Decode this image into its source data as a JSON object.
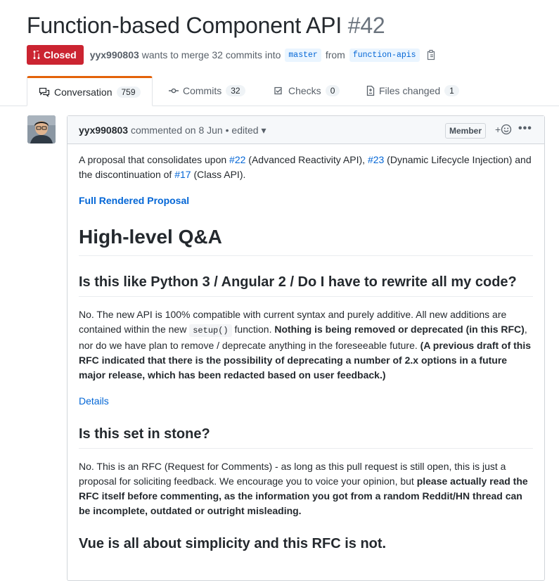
{
  "pr": {
    "title": "Function-based Component API",
    "number": "#42",
    "state": "Closed",
    "author": "yyx990803",
    "merge_text": "wants to merge 32 commits into",
    "base_branch": "master",
    "from_text": "from",
    "head_branch": "function-apis"
  },
  "tabs": [
    {
      "label": "Conversation",
      "count": "759"
    },
    {
      "label": "Commits",
      "count": "32"
    },
    {
      "label": "Checks",
      "count": "0"
    },
    {
      "label": "Files changed",
      "count": "1"
    }
  ],
  "comment": {
    "author": "yyx990803",
    "action": "commented on 8 Jun",
    "edited": "edited",
    "role": "Member",
    "more": "•••",
    "intro": {
      "t1": "A proposal that consolidates upon ",
      "l1": "#22",
      "t2": " (Advanced Reactivity API), ",
      "l2": "#23",
      "t3": " (Dynamic Lifecycle Injection) and the discontinuation of ",
      "l3": "#17",
      "t4": " (Class API)."
    },
    "rendered_link": "Full Rendered Proposal",
    "h_qa": "High-level Q&A",
    "q1": "Is this like Python 3 / Angular 2 / Do I have to rewrite all my code?",
    "a1": {
      "t1": "No. The new API is 100% compatible with current syntax and purely additive. All new additions are contained within the new ",
      "code": "setup()",
      "t2": " function. ",
      "b1": "Nothing is being removed or deprecated (in this RFC)",
      "t3": ", nor do we have plan to remove / deprecate anything in the foreseeable future. ",
      "b2": "(A previous draft of this RFC indicated that there is the possibility of deprecating a number of 2.x options in a future major release, which has been redacted based on user feedback.)"
    },
    "details_link": "Details",
    "q2": "Is this set in stone?",
    "a2": {
      "t1": "No. This is an RFC (Request for Comments) - as long as this pull request is still open, this is just a proposal for soliciting feedback. We encourage you to voice your opinion, but ",
      "b1": "please actually read the RFC itself before commenting, as the information you got from a random Reddit/HN thread can be incomplete, outdated or outright misleading."
    },
    "q3": "Vue is all about simplicity and this RFC is not."
  },
  "colors": {
    "closed": "#cb2431",
    "link": "#0366d6",
    "active_tab_border": "#e36209"
  }
}
